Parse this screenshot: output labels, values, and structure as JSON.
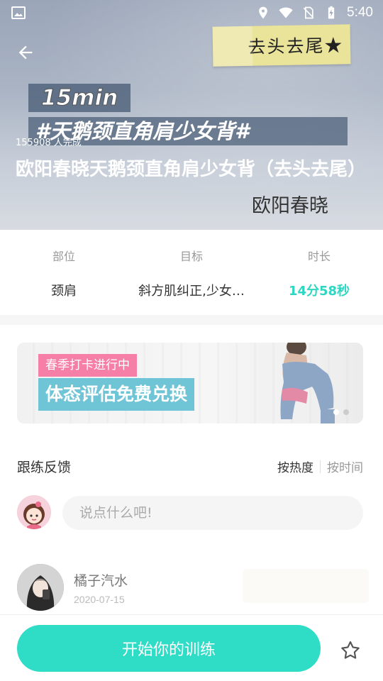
{
  "status_bar": {
    "time": "5:40",
    "icons": [
      "image-icon",
      "location-icon",
      "wifi-icon",
      "no-sim-icon",
      "battery-charging-icon"
    ]
  },
  "hero": {
    "sticky_note": "去头去尾★",
    "banner_duration": "15min",
    "banner_title": "#天鹅颈直角肩少女背#",
    "completed": "155908 人完成",
    "course_title": "欧阳春晓天鹅颈直角肩少女背（去头去尾）",
    "author_signature": "欧阳春晓"
  },
  "info": {
    "items": [
      {
        "label": "部位",
        "value": "颈肩"
      },
      {
        "label": "目标",
        "value": "斜方肌纠正,少女…"
      },
      {
        "label": "时长",
        "value": "14分58秒"
      }
    ],
    "accent_color": "#2fd6c2"
  },
  "ad_banner": {
    "tag_small": "春季打卡进行中",
    "tag_large": "体态评估免费兑换",
    "page_count": 2,
    "active_page": 1
  },
  "feedback": {
    "title": "跟练反馈",
    "sort_hot": "按热度",
    "sort_time": "按时间",
    "input_placeholder": "说点什么吧!"
  },
  "comments": [
    {
      "user": "橘子汽水",
      "date": "2020-07-15"
    }
  ],
  "bottom_bar": {
    "start_label": "开始你的训练",
    "button_color": "#2fdcc6"
  }
}
